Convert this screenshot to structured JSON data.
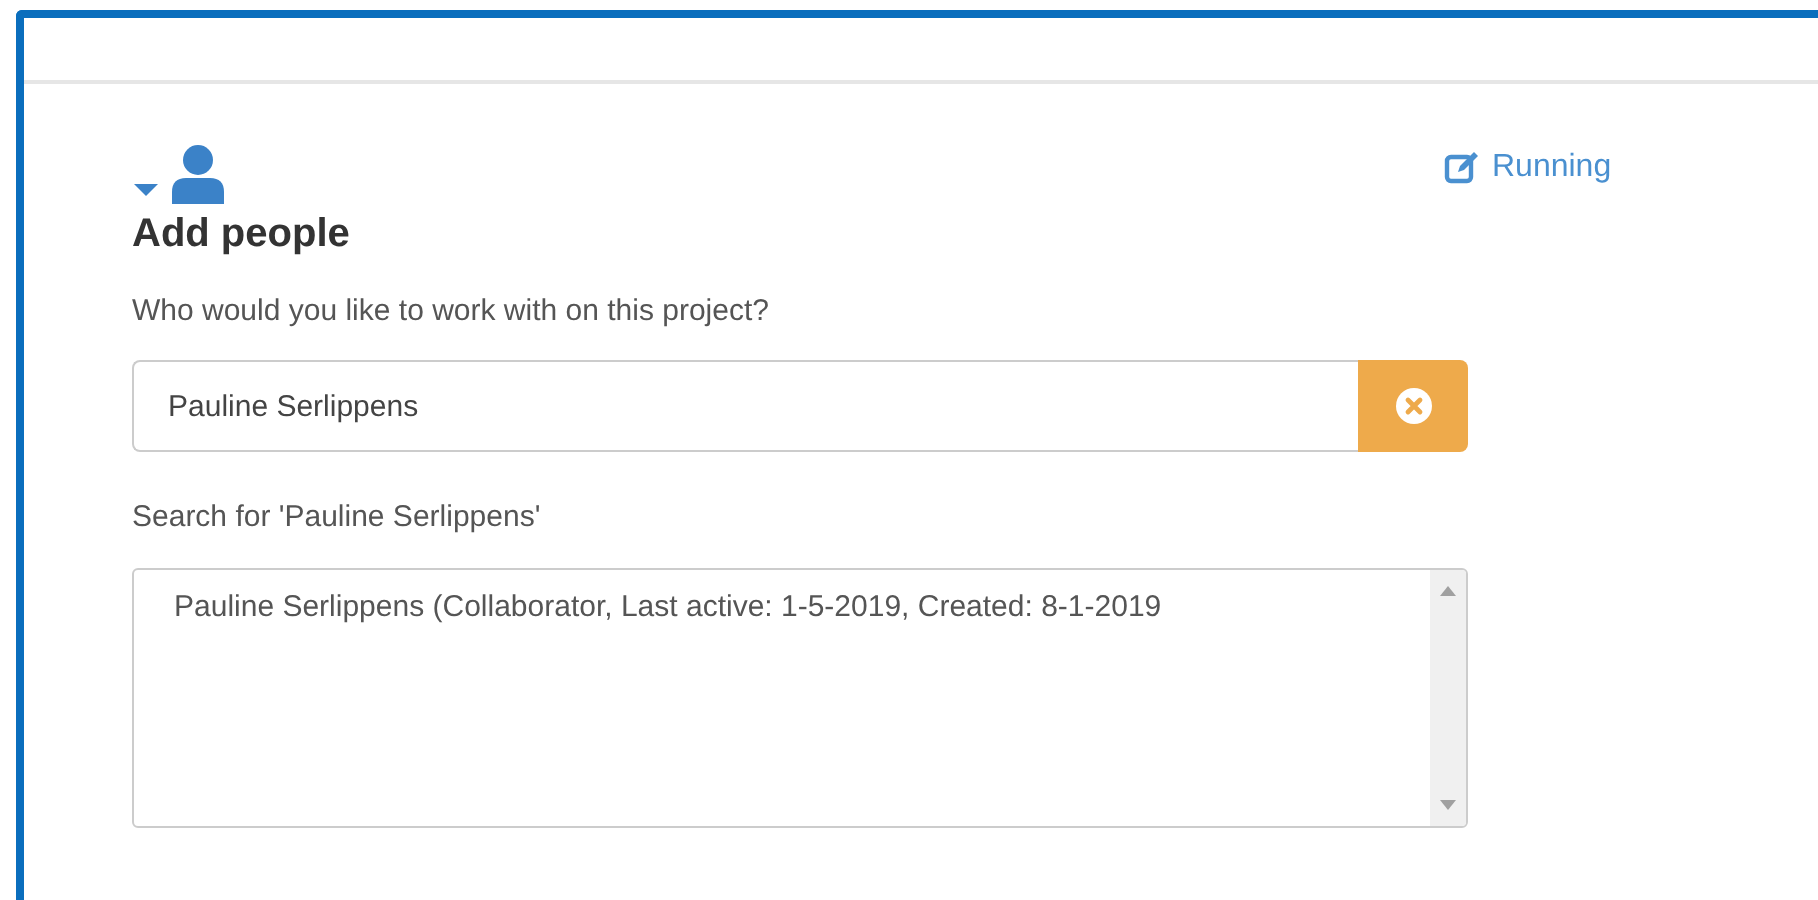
{
  "section": {
    "expanded": true,
    "title": "Add people",
    "status": "Running",
    "prompt": "Who would you like to work with on this project?"
  },
  "search": {
    "value": "Pauline Serlippens",
    "caption": "Search for 'Pauline Serlippens'"
  },
  "results": [
    {
      "label": "Pauline Serlippens (Collaborator, Last active: 1-5-2019, Created: 8-1-2019",
      "selected": false
    }
  ]
}
